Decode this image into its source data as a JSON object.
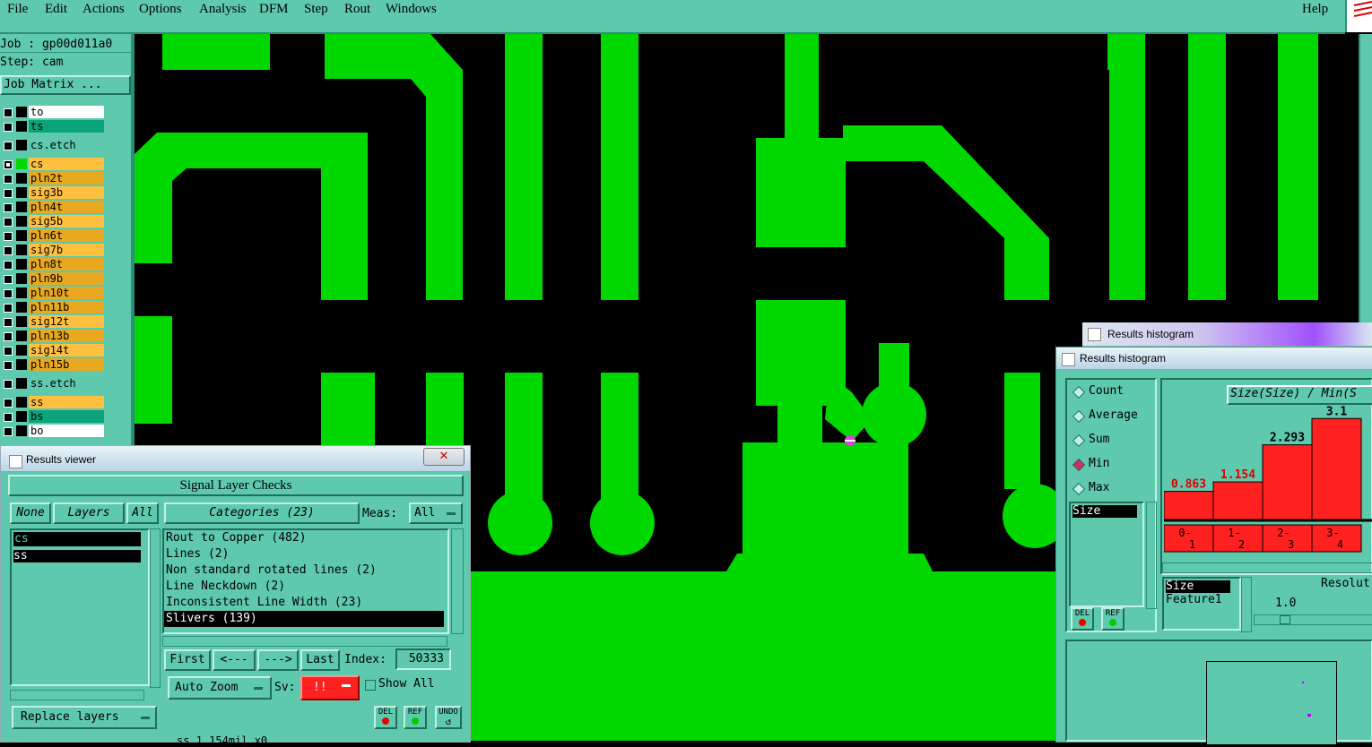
{
  "menu": {
    "items": [
      "File",
      "Edit",
      "Actions",
      "Options",
      "Analysis",
      "DFM",
      "Step",
      "Rout",
      "Windows"
    ],
    "help": "Help"
  },
  "job": {
    "job_label": "Job : gp00d011a0",
    "step_label": "Step: cam",
    "matrix_button": "Job Matrix ..."
  },
  "layers": [
    {
      "name": "to",
      "color": "#ffffff",
      "swatch": "#000000"
    },
    {
      "name": "ts",
      "color": "#0aa37a",
      "swatch": "#000000"
    },
    {
      "name": "cs.etch",
      "color": "#5ec9ad",
      "swatch": "#000000"
    },
    {
      "name": "cs",
      "color": "#ffc040",
      "swatch": "#00d800"
    },
    {
      "name": "pln2t",
      "color": "#e8a820",
      "swatch": "#000000"
    },
    {
      "name": "sig3b",
      "color": "#ffc040",
      "swatch": "#000000"
    },
    {
      "name": "pln4t",
      "color": "#e8a820",
      "swatch": "#000000"
    },
    {
      "name": "sig5b",
      "color": "#ffc040",
      "swatch": "#000000"
    },
    {
      "name": "pln6t",
      "color": "#e8a820",
      "swatch": "#000000"
    },
    {
      "name": "sig7b",
      "color": "#ffc040",
      "swatch": "#000000"
    },
    {
      "name": "pln8t",
      "color": "#e8a820",
      "swatch": "#000000"
    },
    {
      "name": "pln9b",
      "color": "#e8a820",
      "swatch": "#000000"
    },
    {
      "name": "pln10t",
      "color": "#e8a820",
      "swatch": "#000000"
    },
    {
      "name": "pln11b",
      "color": "#e8a820",
      "swatch": "#000000"
    },
    {
      "name": "sig12t",
      "color": "#ffc040",
      "swatch": "#000000"
    },
    {
      "name": "pln13b",
      "color": "#e8a820",
      "swatch": "#000000"
    },
    {
      "name": "sig14t",
      "color": "#ffc040",
      "swatch": "#000000"
    },
    {
      "name": "pln15b",
      "color": "#e8a820",
      "swatch": "#000000"
    },
    {
      "name": "ss.etch",
      "color": "#5ec9ad",
      "swatch": "#000000"
    },
    {
      "name": "ss",
      "color": "#ffc040",
      "swatch": "#000000"
    },
    {
      "name": "bs",
      "color": "#0aa37a",
      "swatch": "#000000"
    },
    {
      "name": "bo",
      "color": "#ffffff",
      "swatch": "#000000"
    }
  ],
  "results_viewer": {
    "title": "Results viewer",
    "header": "Signal Layer Checks",
    "none_btn": "None",
    "layers_btn": "Layers",
    "all_btn": "All",
    "categories_btn": "Categories (23)",
    "meas_label": "Meas:",
    "meas_value": "All",
    "layer_list": [
      "cs",
      "ss"
    ],
    "categories": [
      "Rout to Copper (482)",
      "Lines (2)",
      "Non standard rotated lines (2)",
      "Line Neckdown (2)",
      "Inconsistent Line Width (23)",
      "Slivers (139)"
    ],
    "first_btn": "First",
    "prev_btn": "<---",
    "next_btn": "--->",
    "last_btn": "Last",
    "index_label": "Index:",
    "index_value": "50333",
    "zoom_value": "Auto Zoom",
    "sv_label": "Sv:",
    "sv_value": "!!",
    "show_all": "Show All",
    "replace_layers": "Replace layers",
    "del": "DEL",
    "ref": "REF",
    "undo": "UNDO",
    "status_partial": "ss 1.154mil  x0"
  },
  "histogram_back": {
    "title": "Results histogram"
  },
  "histogram": {
    "title": "Results histogram",
    "modes": [
      "Count",
      "Average",
      "Sum",
      "Min",
      "Max"
    ],
    "selected_mode": "Min",
    "attr_list": [
      "Size"
    ],
    "chart_title": "Size(Size) / Min(S",
    "bin_list": [
      "Size",
      "Feature1"
    ],
    "resolution_label": "Resolut",
    "resolution_value": "1.0",
    "del": "DEL",
    "ref": "REF"
  },
  "chart_data": {
    "type": "bar",
    "categories": [
      "0-1",
      "1-2",
      "2-3",
      "3-4"
    ],
    "values": [
      0.863,
      1.154,
      2.293,
      3.1
    ],
    "value_labels": [
      "0.863",
      "1.154",
      "2.293",
      "3.1"
    ],
    "ylim": [
      0,
      3.3
    ],
    "bar_color": "#ff2020"
  }
}
